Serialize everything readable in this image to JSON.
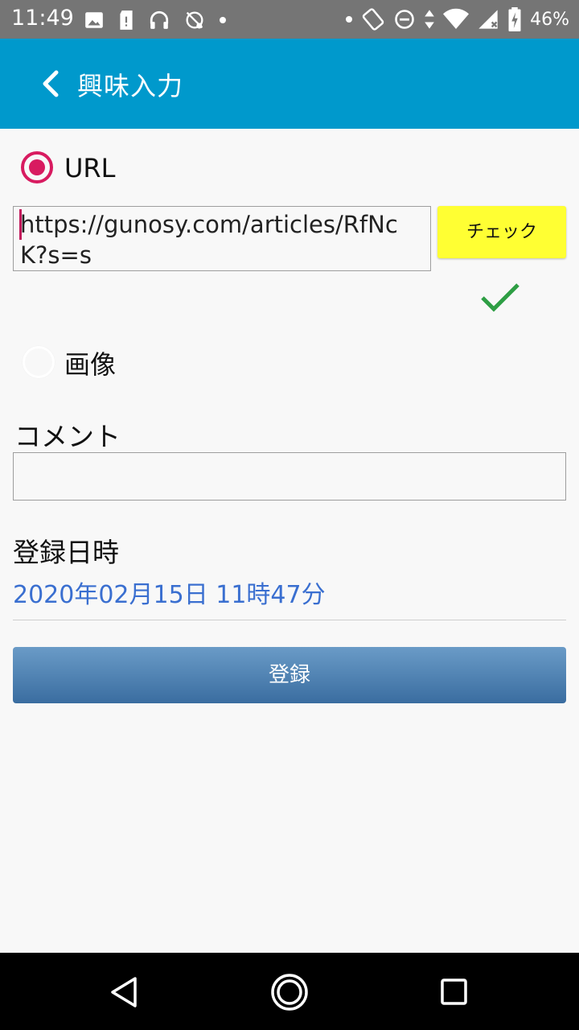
{
  "status_bar": {
    "time": "11:49",
    "battery": "46%",
    "icons_left": [
      "image-icon",
      "sd-card-icon",
      "headphones-icon",
      "location-off-icon",
      "dot-icon"
    ],
    "icons_right": [
      "dot-icon",
      "rotate-icon",
      "do-not-disturb-icon",
      "data-arrows-icon",
      "wifi-icon",
      "no-signal-icon",
      "battery-charging-icon"
    ]
  },
  "app_bar": {
    "title": "興味入力"
  },
  "form": {
    "url_option_label": "URL",
    "url_value": "https://gunosy.com/articles/RfNcK?s=s",
    "check_button_label": "チェック",
    "image_option_label": "画像",
    "comment_label": "コメント",
    "comment_value": "",
    "date_label": "登録日時",
    "date_value": "2020年02月15日 11時47分",
    "register_button_label": "登録"
  },
  "colors": {
    "app_bar": "#0099cc",
    "radio_accent": "#d81b60",
    "check_button": "#ffff33",
    "checkmark": "#2e9e44",
    "date_text": "#3a6fd0"
  }
}
